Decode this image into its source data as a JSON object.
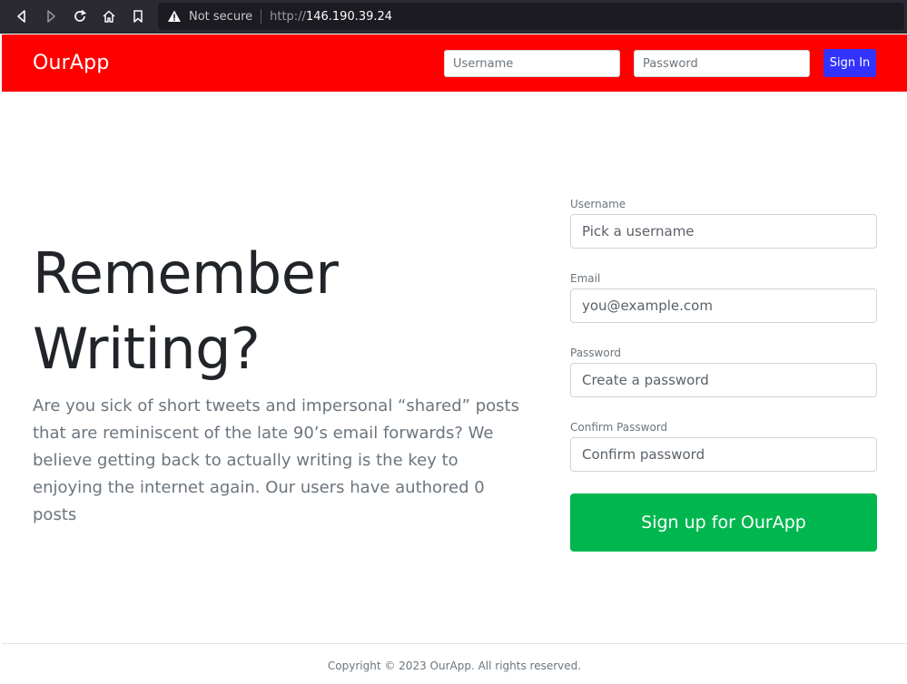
{
  "browser": {
    "security_label": "Not secure",
    "url_scheme": "http://",
    "url_host": "146.190.39.24",
    "icons": [
      "back-icon",
      "forward-icon",
      "reload-icon",
      "home-icon",
      "bookmark-icon",
      "warning-icon"
    ]
  },
  "header": {
    "brand": "OurApp",
    "username_placeholder": "Username",
    "password_placeholder": "Password",
    "signin_label": "Sign In",
    "background_color": "#ff0000",
    "signin_color": "#3333ff"
  },
  "hero": {
    "headline": "Remember Writing?",
    "lead": "Are you sick of short tweets and impersonal “shared” posts that are reminiscent of the late 90’s email forwards? We believe getting back to actually writing is the key to enjoying the internet again. Our users have authored 0 posts"
  },
  "signup": {
    "username_label": "Username",
    "username_placeholder": "Pick a username",
    "email_label": "Email",
    "email_placeholder": "you@example.com",
    "password_label": "Password",
    "password_placeholder": "Create a password",
    "confirm_label": "Confirm Password",
    "confirm_placeholder": "Confirm password",
    "submit_label": "Sign up for OurApp",
    "submit_color": "#00b74f"
  },
  "footer": {
    "copyright": "Copyright © 2023 OurApp. All rights reserved."
  }
}
